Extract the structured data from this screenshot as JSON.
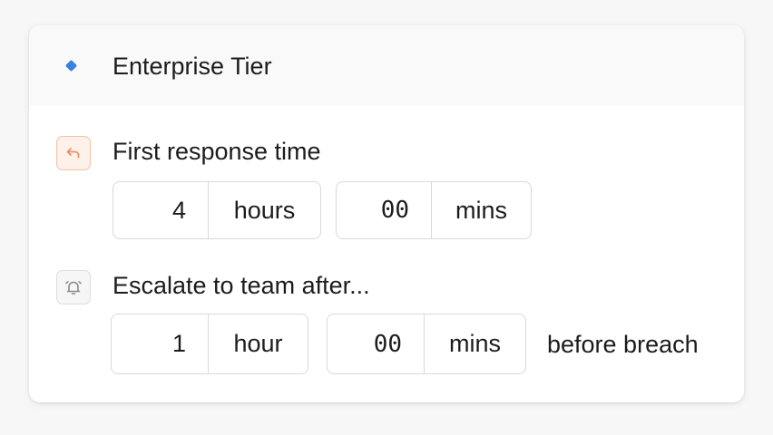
{
  "tier": {
    "title": "Enterprise Tier",
    "dot_color": "#3b82e0",
    "dot_icon": "diamond-icon"
  },
  "first_response": {
    "label": "First response time",
    "icon": "reply-icon",
    "hours": {
      "value": "4",
      "unit": "hours"
    },
    "minutes": {
      "value": "00",
      "unit": "mins"
    }
  },
  "escalation": {
    "label": "Escalate to team after...",
    "icon": "alarm-bell-icon",
    "hours": {
      "value": "1",
      "unit": "hour"
    },
    "minutes": {
      "value": "00",
      "unit": "mins"
    },
    "suffix": "before breach"
  },
  "colors": {
    "reply_icon_accent": "#e8916a",
    "border": "#d9d9de"
  }
}
